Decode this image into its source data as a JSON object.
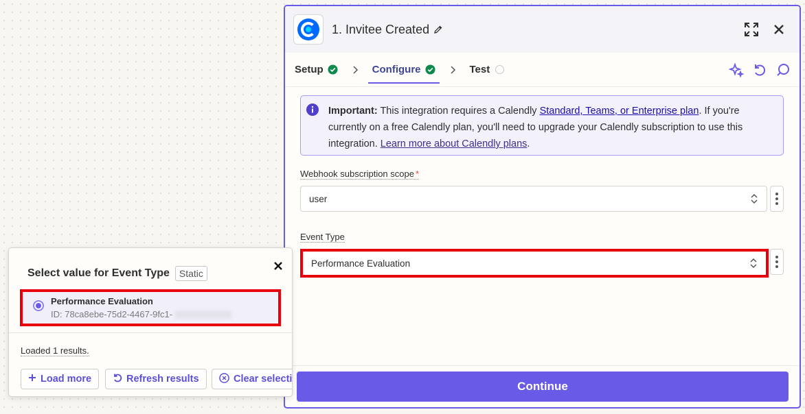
{
  "panel": {
    "title": "1. Invitee Created",
    "tabs": [
      {
        "label": "Setup",
        "status": "complete"
      },
      {
        "label": "Configure",
        "status": "complete"
      },
      {
        "label": "Test",
        "status": "pending"
      }
    ],
    "notice": {
      "bold": "Important:",
      "text1": " This integration requires a Calendly ",
      "link1": "Standard, Teams, or Enterprise plan",
      "text2": ". If you're currently on a free Calendly plan, you'll need to upgrade your Calendly subscription to use this integration. ",
      "link2": "Learn more about Calendly plans",
      "text3": "."
    },
    "fields": {
      "scope_label": "Webhook subscription scope",
      "scope_required": "*",
      "scope_value": "user",
      "event_label": "Event Type",
      "event_value": "Performance Evaluation"
    },
    "continue_label": "Continue"
  },
  "popover": {
    "title": "Select value for Event Type",
    "badge": "Static",
    "option_name": "Performance Evaluation",
    "option_id": "ID: 78ca8ebe-75d2-4467-9fc1-",
    "loaded_text": "Loaded 1 results.",
    "buttons": {
      "load_more": "Load more",
      "refresh": "Refresh results",
      "clear": "Clear selection"
    }
  },
  "colors": {
    "accent": "#695be8",
    "highlight": "#e8000b",
    "success": "#0f884e"
  }
}
